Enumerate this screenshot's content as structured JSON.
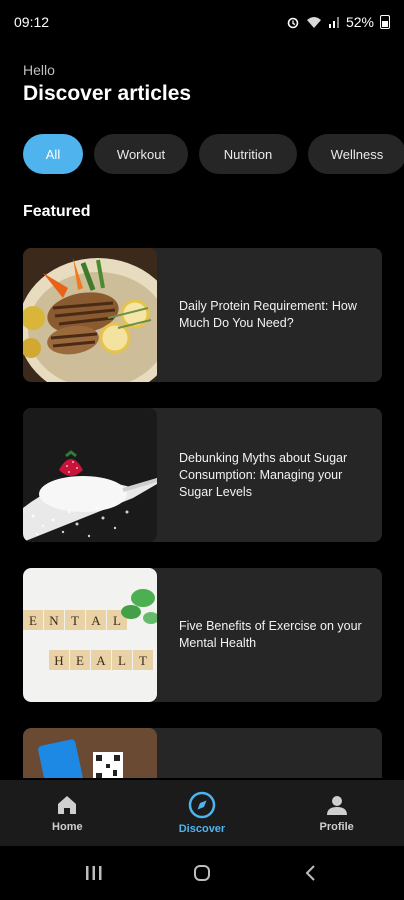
{
  "status_bar": {
    "time": "09:12",
    "battery": "52%"
  },
  "header": {
    "greeting": "Hello",
    "title": "Discover articles"
  },
  "chips": [
    {
      "label": "All",
      "active": true
    },
    {
      "label": "Workout",
      "active": false
    },
    {
      "label": "Nutrition",
      "active": false
    },
    {
      "label": "Wellness",
      "active": false
    }
  ],
  "featured_title": "Featured",
  "articles": [
    {
      "title": "Daily Protein Requirement: How Much Do You Need?",
      "image": "grilled-chicken-image"
    },
    {
      "title": "Debunking Myths about Sugar Consumption: Managing your Sugar Levels",
      "image": "sugar-spoon-image"
    },
    {
      "title": "Five Benefits of Exercise on your Mental Health",
      "image": "mental-health-tiles-image"
    },
    {
      "title": "",
      "image": "phone-qr-image"
    }
  ],
  "bottom_nav": [
    {
      "label": "Home",
      "icon": "home-icon",
      "active": false
    },
    {
      "label": "Discover",
      "icon": "compass-icon",
      "active": true
    },
    {
      "label": "Profile",
      "icon": "person-icon",
      "active": false
    }
  ],
  "colors": {
    "accent": "#4fb3ee",
    "card_bg": "#262626",
    "background": "#000000"
  }
}
